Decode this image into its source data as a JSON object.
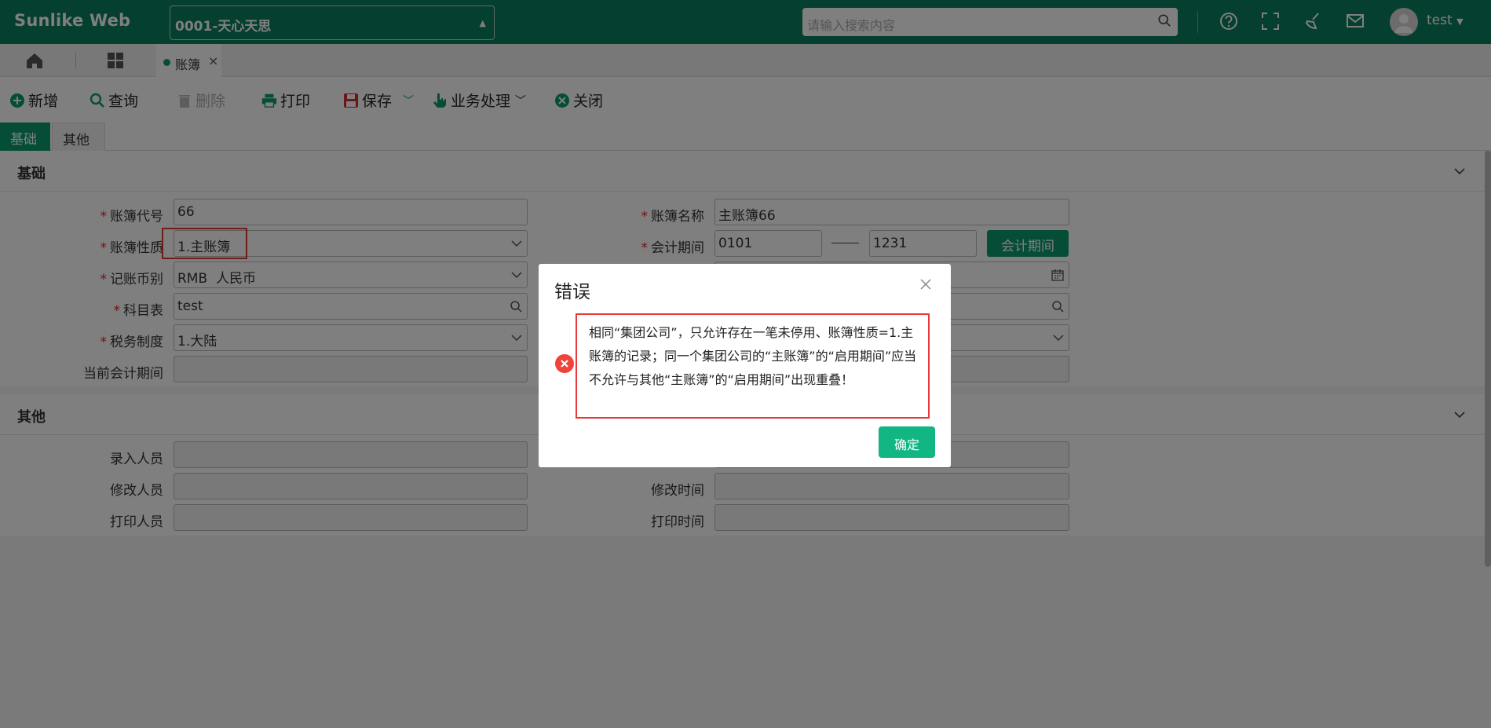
{
  "header": {
    "brand": "Sunlike Web",
    "company": "0001-天心天思",
    "search_placeholder": "请输入搜索内容",
    "user": "test",
    "icons": [
      "help-icon",
      "fullscreen-icon",
      "clean-icon",
      "mail-icon",
      "user-avatar-icon"
    ],
    "color": "#0a7f5e"
  },
  "tabs": {
    "doc_tab": "账簿"
  },
  "toolbar": {
    "new": "新增",
    "query": "查询",
    "delete": "删除",
    "print": "打印",
    "save": "保存",
    "business": "业务处理",
    "close": "关闭"
  },
  "form_tabs": [
    "基础",
    "其他"
  ],
  "basic": {
    "title": "基础",
    "book_code_label": "账簿代号",
    "book_code": "66",
    "book_name_label": "账簿名称",
    "book_name": "主账簿66",
    "book_type_label": "账簿性质",
    "book_type": "1.主账簿",
    "period_label": "会计期间",
    "period_from": "0101",
    "period_to": "1231",
    "period_button": "会计期间",
    "currency_label": "记账币别",
    "currency": "RMB  人民币",
    "subject_label": "科目表",
    "subject": "test",
    "tax_label": "税务制度",
    "tax": "1.大陆",
    "current_period_label": "当前会计期间"
  },
  "other": {
    "title": "其他",
    "creator_label": "录入人员",
    "modifier_label": "修改人员",
    "modify_time_label": "修改时间",
    "printer_label": "打印人员",
    "print_time_label": "打印时间"
  },
  "dialog": {
    "title": "错误",
    "message": "相同“集团公司”，只允许存在一笔未停用、账簿性质=1.主账簿的记录；同一个集团公司的“主账簿”的“启用期间”应当不允许与其他“主账簿”的“启用期间”出现重叠！",
    "ok": "确定"
  }
}
